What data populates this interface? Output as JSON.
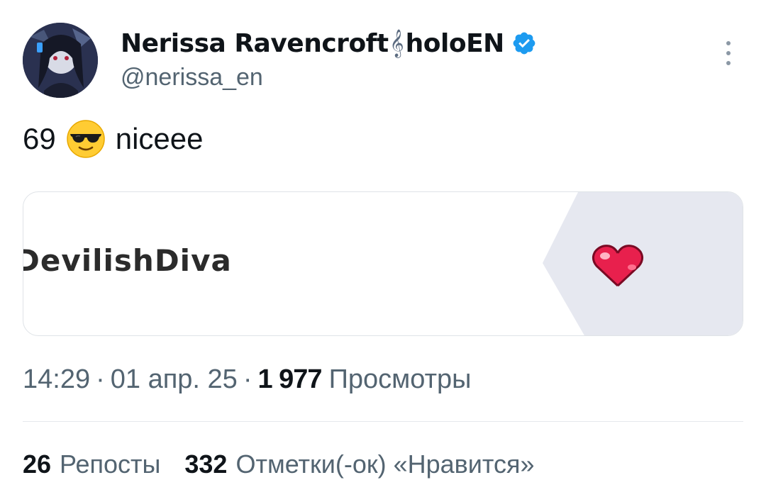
{
  "author": {
    "display_name_part1": "Nerissa Ravencroft",
    "display_name_symbol": "𝄞",
    "display_name_part2": "holoEN",
    "handle": "@nerissa_en",
    "verified": true,
    "verified_color": "#1d9bf0"
  },
  "tweet": {
    "text_before": "69",
    "emoji": "smiling-face-with-sunglasses",
    "text_after": "niceee"
  },
  "media": {
    "banner_text": "DevilishDiva",
    "accent_color": "#e6e8f0",
    "heart_color": "#e8204d"
  },
  "meta": {
    "time": "14:29",
    "separator": "·",
    "date": "01 апр. 25",
    "views_count": "1 977",
    "views_label": "Просмотры"
  },
  "stats": {
    "reposts_count": "26",
    "reposts_label": "Репосты",
    "likes_count": "332",
    "likes_label": "Отметки(-ок) «Нравится»"
  }
}
